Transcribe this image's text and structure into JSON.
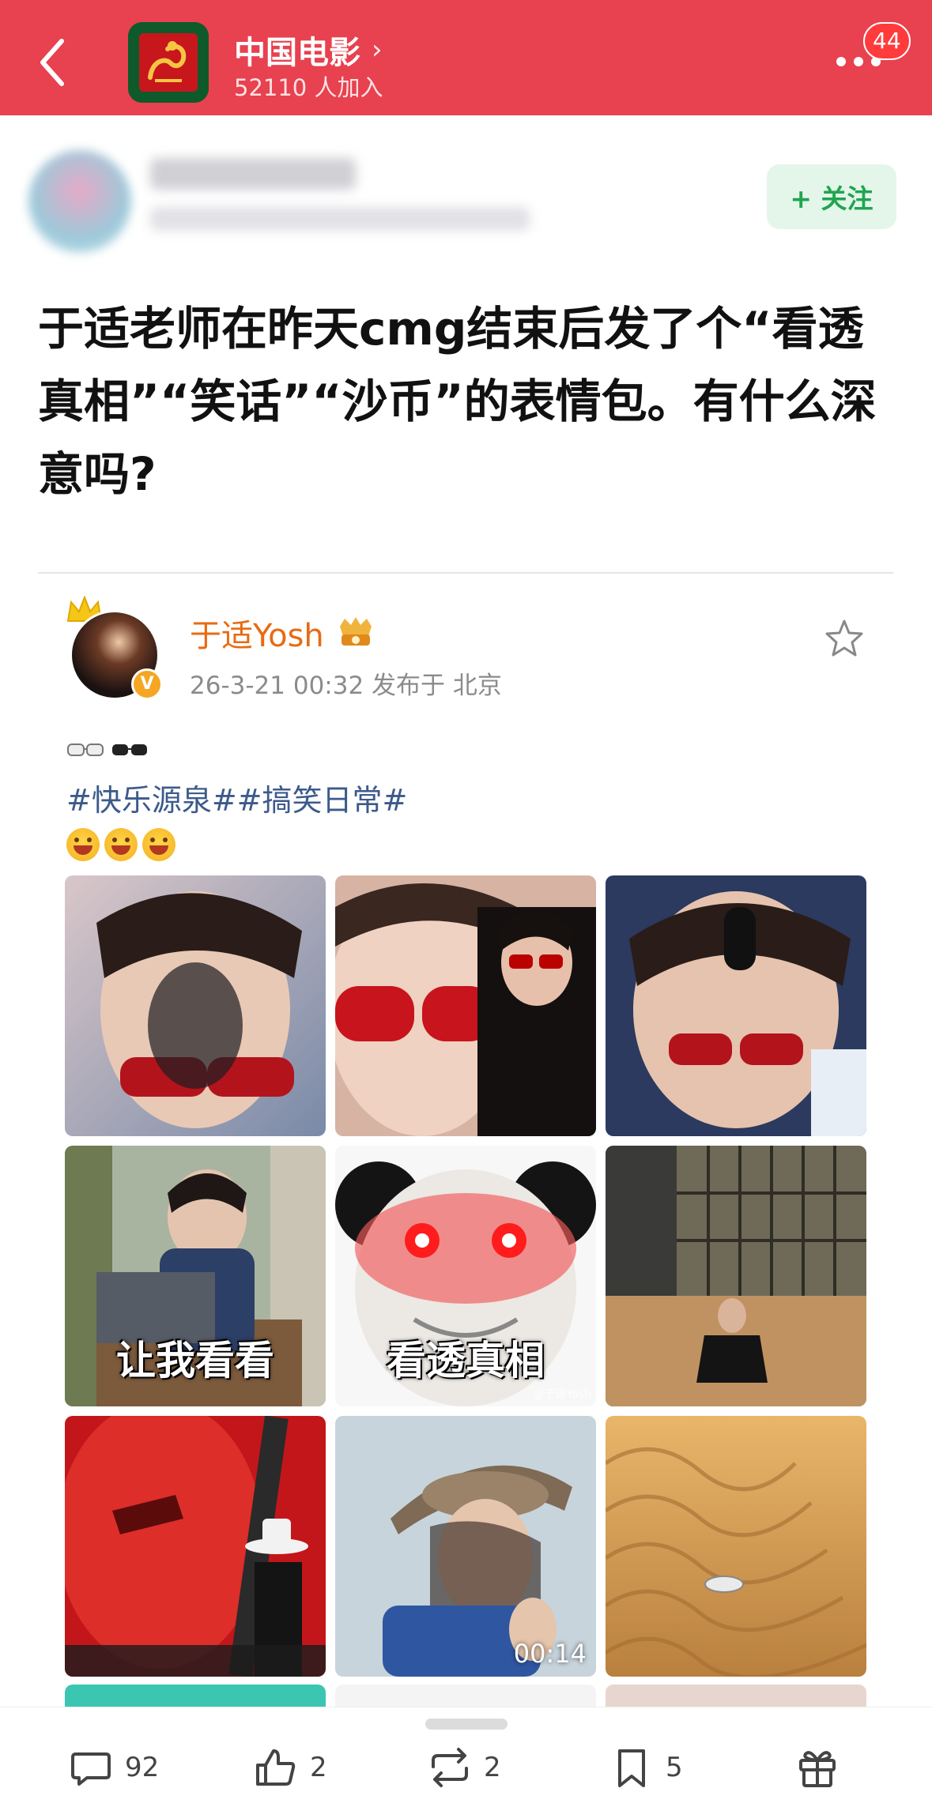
{
  "header": {
    "group_name": "中国电影",
    "member_count": "52110 人加入",
    "notification_count": "44",
    "chevron": "›"
  },
  "post": {
    "follow_label": "+ 关注",
    "title": "于适老师在昨天cmg结束后发了个“看透真相”“笑话”“沙币”的表情包。有什么深意吗?"
  },
  "weibo": {
    "author": "于适Yosh",
    "meta": "26-3-21 00:32  发布于 北京",
    "hashtags": "#快乐源泉##搞笑日常#",
    "verified_badge": "V",
    "images": [
      {
        "caption": "",
        "duration": ""
      },
      {
        "caption": "",
        "duration": ""
      },
      {
        "caption": "",
        "duration": ""
      },
      {
        "caption": "让我看看",
        "duration": ""
      },
      {
        "caption": "看透真相",
        "duration": "",
        "watermark": "@于适Yosh"
      },
      {
        "caption": "",
        "duration": ""
      },
      {
        "caption": "",
        "duration": ""
      },
      {
        "caption": "",
        "duration": "00:14"
      },
      {
        "caption": "",
        "duration": ""
      }
    ]
  },
  "bottom_bar": {
    "comments": "92",
    "likes": "2",
    "reposts": "2",
    "favorites": "5"
  },
  "colors": {
    "brand_red": "#e8414f",
    "follow_green": "#1fa54f",
    "author_orange": "#e86a12",
    "hashtag_blue": "#3c5a8c"
  },
  "icons": [
    "back-arrow-icon",
    "more-dots-icon",
    "star-icon",
    "comment-icon",
    "like-icon",
    "repost-icon",
    "bookmark-icon",
    "gift-icon"
  ]
}
